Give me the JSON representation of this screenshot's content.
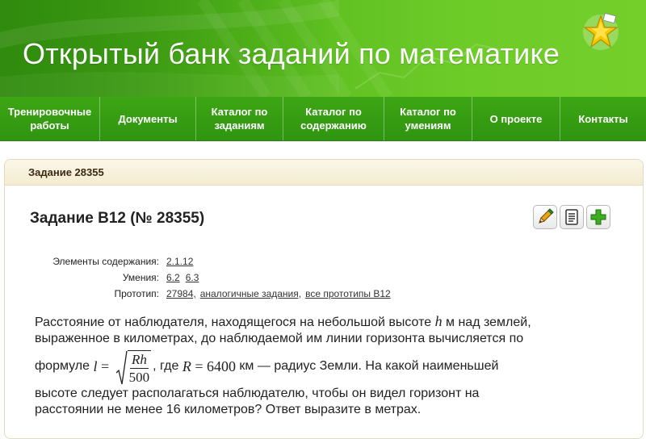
{
  "header": {
    "title": "Открытый банк заданий по математике",
    "logo_icon": "star-logo-icon"
  },
  "nav": {
    "items": [
      {
        "label": "Тренировочные\nработы"
      },
      {
        "label": "Документы"
      },
      {
        "label": "Каталог по\nзаданиям"
      },
      {
        "label": "Каталог по\nсодержанию"
      },
      {
        "label": "Каталог по\nумениям"
      },
      {
        "label": "О проекте"
      },
      {
        "label": "Контакты"
      }
    ]
  },
  "panel": {
    "breadcrumb": "Задание 28355",
    "title": "Задание B12 (№ 28355)",
    "tools": [
      "pencil-icon",
      "document-icon",
      "plus-icon"
    ],
    "meta": {
      "content_label": "Элементы содержания:",
      "content_links": [
        "2.1.12"
      ],
      "skills_label": "Умения:",
      "skills_links": [
        "6.2",
        "6.3"
      ],
      "prototype_label": "Прототип:",
      "prototype_links": [
        "27984,",
        "аналогичные задания,",
        "все прототипы B12"
      ]
    },
    "problem": {
      "line1_a": "Расстояние от наблюдателя, находящегося на небольшой высоте ",
      "var_h": "h",
      "line1_b": " м над землей,",
      "line2": "выраженное в километрах, до наблюдаемой им линии горизонта вычисляется по",
      "formula_prefix": "формуле ",
      "var_l": "l",
      "eq": " = ",
      "frac_num": "Rh",
      "frac_den": "500",
      "after_frac": ", где ",
      "var_R": "R",
      "R_value": " = 6400",
      "after_R": " км — радиус Земли. На какой наименьшей",
      "line4": "высоте следует располагаться наблюдателю, чтобы он видел горизонт на",
      "line5": "расстоянии не менее 16 километров? Ответ выразите в метрах."
    }
  },
  "colors": {
    "header_green": "#55b81c",
    "nav_green": "#3da614",
    "panel_head": "#f3ecd2"
  }
}
